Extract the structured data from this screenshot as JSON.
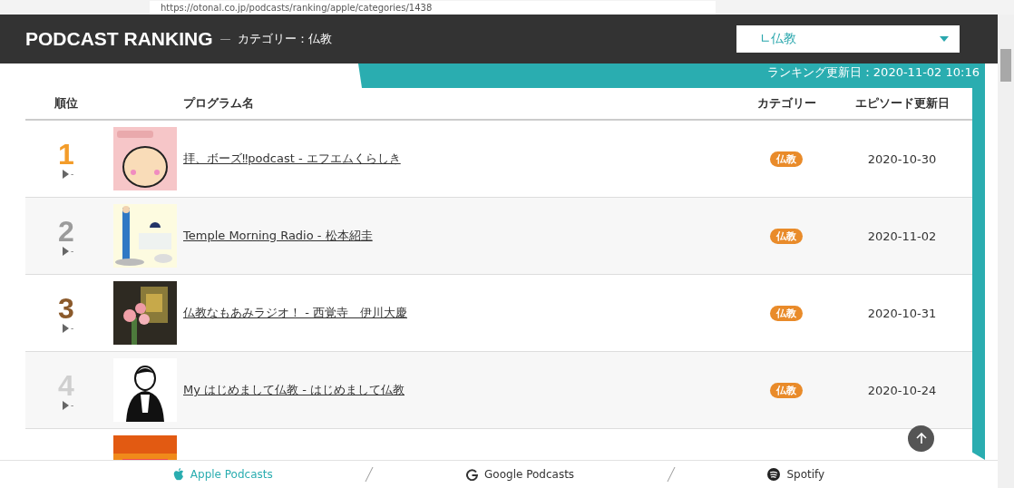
{
  "browser": {
    "url": "https://otonal.co.jp/podcasts/ranking/apple/categories/1438"
  },
  "header": {
    "title": "PODCAST RANKING",
    "dash": "—",
    "subtitle": "カテゴリー：仏教",
    "select_value": "∟仏教"
  },
  "updated": "ランキング更新日：2020-11-02 10:16",
  "table": {
    "columns": [
      "順位",
      "プログラム名",
      "カテゴリー",
      "エピソード更新日"
    ],
    "rows": [
      {
        "rank": "1",
        "color": "#f39c2a",
        "change": "-",
        "title": "拝、ボーズ‼podcast - エフエムくらしき",
        "category": "仏教",
        "date": "2020-10-30"
      },
      {
        "rank": "2",
        "color": "#9b9b9b",
        "change": "-",
        "title": "Temple Morning Radio - 松本紹圭",
        "category": "仏教",
        "date": "2020-11-02"
      },
      {
        "rank": "3",
        "color": "#8b5a2b",
        "change": "-",
        "title": "仏教なもあみラジオ！ - 西覚寺　伊川大慶",
        "category": "仏教",
        "date": "2020-10-31"
      },
      {
        "rank": "4",
        "color": "#cfcfcf",
        "change": "-",
        "title": "My はじめまして仏教 - はじめまして仏教",
        "category": "仏教",
        "date": "2020-10-24"
      },
      {
        "kind": "picture"
      }
    ]
  },
  "footer": {
    "links": [
      {
        "label": "Apple Podcasts",
        "selected": true
      },
      {
        "label": "Google Podcasts",
        "selected": false
      },
      {
        "label": "Spotify",
        "selected": false
      }
    ]
  }
}
